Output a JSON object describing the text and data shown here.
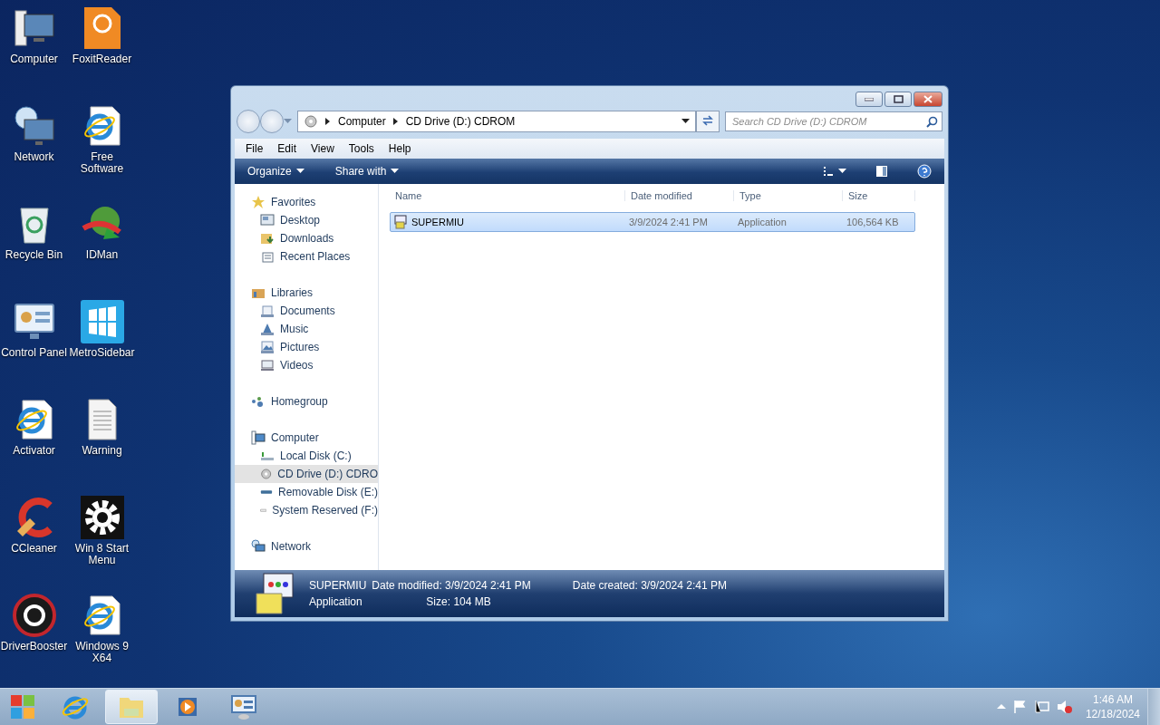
{
  "desktop_icons": [
    {
      "label": "Computer",
      "kind": "computer"
    },
    {
      "label": "FoxitReader",
      "kind": "pdf"
    },
    {
      "label": "Network",
      "kind": "network"
    },
    {
      "label": "Free Software",
      "kind": "ie"
    },
    {
      "label": "Recycle Bin",
      "kind": "recycle"
    },
    {
      "label": "IDMan",
      "kind": "globe"
    },
    {
      "label": "Control Panel",
      "kind": "panel"
    },
    {
      "label": "MetroSidebar",
      "kind": "metro"
    },
    {
      "label": "Activator",
      "kind": "ie"
    },
    {
      "label": "Warning",
      "kind": "document"
    },
    {
      "label": "CCleaner",
      "kind": "cleaner"
    },
    {
      "label": "Win 8 Start Menu",
      "kind": "gear"
    },
    {
      "label": "DriverBooster",
      "kind": "booster"
    },
    {
      "label": "Windows 9 X64",
      "kind": "ie"
    }
  ],
  "window": {
    "address": {
      "crumbs": [
        "Computer",
        "CD Drive (D:) CDROM"
      ]
    },
    "search": {
      "placeholder": "Search CD Drive (D:) CDROM"
    },
    "menu": [
      "File",
      "Edit",
      "View",
      "Tools",
      "Help"
    ],
    "toolbar": [
      "Organize",
      "Share with"
    ],
    "sidebar": [
      {
        "label": "Favorites",
        "kind": "star",
        "selected": false,
        "children": [
          {
            "label": "Desktop",
            "kind": "desktop",
            "selected": false
          },
          {
            "label": "Downloads",
            "kind": "download",
            "selected": false
          },
          {
            "label": "Recent Places",
            "kind": "recent",
            "selected": false
          }
        ]
      },
      {
        "label": "Libraries",
        "kind": "library",
        "selected": false,
        "children": [
          {
            "label": "Documents",
            "kind": "document",
            "selected": false
          },
          {
            "label": "Music",
            "kind": "music",
            "selected": false
          },
          {
            "label": "Pictures",
            "kind": "picture",
            "selected": false
          },
          {
            "label": "Videos",
            "kind": "video",
            "selected": false
          }
        ]
      },
      {
        "label": "Homegroup",
        "kind": "homegroup",
        "selected": false
      },
      {
        "label": "Computer",
        "kind": "computer",
        "selected": false,
        "children": [
          {
            "label": "Local Disk (C:)",
            "kind": "disk",
            "selected": false
          },
          {
            "label": "CD Drive (D:) CDRO",
            "kind": "cd",
            "selected": true
          },
          {
            "label": "Removable Disk (E:)",
            "kind": "usb",
            "selected": false
          },
          {
            "label": "System Reserved (F:)",
            "kind": "drive",
            "selected": false
          }
        ]
      },
      {
        "label": "Network",
        "kind": "network",
        "selected": false
      }
    ],
    "columns": [
      "Name",
      "Date modified",
      "Type",
      "Size"
    ],
    "rows": [
      {
        "name": "SUPERMIU",
        "date": "3/9/2024 2:41 PM",
        "type": "Application",
        "size": "106,564 KB",
        "selected": true
      }
    ],
    "details": {
      "name": "SUPERMIU",
      "type": "Application",
      "fields": [
        {
          "label": "Date modified:",
          "value": "3/9/2024 2:41 PM"
        },
        {
          "label": "Date created:",
          "value": "3/9/2024 2:41 PM"
        },
        {
          "label": "Size:",
          "value": "104 MB"
        }
      ]
    }
  },
  "taskbar": {
    "items": [
      {
        "kind": "ie",
        "selected": false
      },
      {
        "kind": "folder",
        "selected": true
      },
      {
        "kind": "media",
        "selected": false
      },
      {
        "kind": "panel",
        "selected": false
      }
    ],
    "time": "1:46 AM",
    "date": "12/18/2024"
  }
}
